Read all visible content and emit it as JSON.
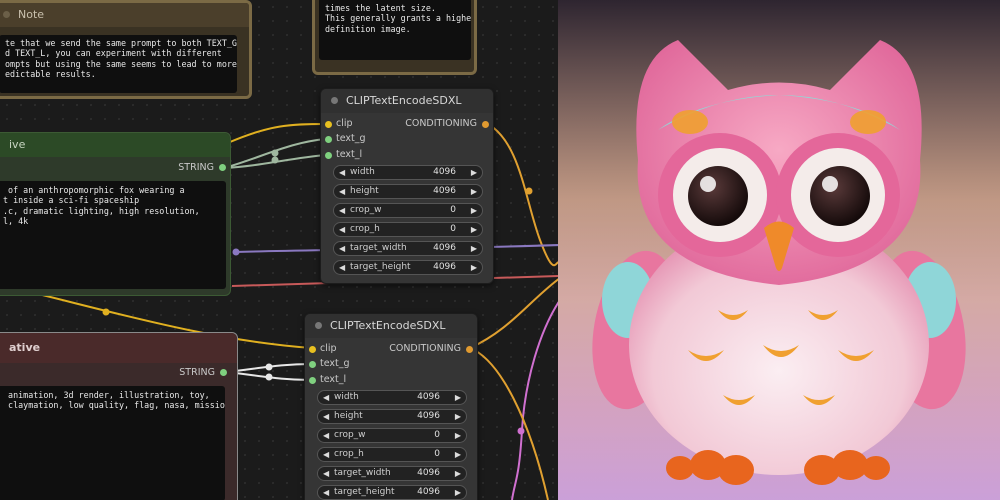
{
  "note_top_left": {
    "title": "Note",
    "lines": [
      "te that we send the same prompt to both TEXT_G",
      "d TEXT_L, you can experiment with different",
      "ompts but using the same seems to lead to more",
      "edictable results."
    ]
  },
  "note_top_center": {
    "lines": [
      "times the latent size.",
      "",
      "This generally grants a higher",
      "definition image."
    ]
  },
  "positive_node": {
    "title": "ive",
    "output_label": "STRING",
    "lines": [
      " of an anthropomorphic fox wearing a",
      "t inside a sci-fi spaceship",
      "",
      ".c, dramatic lighting, high resolution,",
      "l, 4k"
    ]
  },
  "negative_node": {
    "title": "ative",
    "output_label": "STRING",
    "lines": [
      " animation, 3d render, illustration, toy,",
      " claymation, low quality, flag, nasa, mission"
    ]
  },
  "clip_nodes": [
    {
      "title": "CLIPTextEncodeSDXL",
      "inputs": [
        "clip",
        "text_g",
        "text_l"
      ],
      "output": "CONDITIONING",
      "widgets": [
        {
          "label": "width",
          "value": "4096"
        },
        {
          "label": "height",
          "value": "4096"
        },
        {
          "label": "crop_w",
          "value": "0"
        },
        {
          "label": "crop_h",
          "value": "0"
        },
        {
          "label": "target_width",
          "value": "4096"
        },
        {
          "label": "target_height",
          "value": "4096"
        }
      ]
    },
    {
      "title": "CLIPTextEncodeSDXL",
      "inputs": [
        "clip",
        "text_g",
        "text_l"
      ],
      "output": "CONDITIONING",
      "widgets": [
        {
          "label": "width",
          "value": "4096"
        },
        {
          "label": "height",
          "value": "4096"
        },
        {
          "label": "crop_w",
          "value": "0"
        },
        {
          "label": "crop_h",
          "value": "0"
        },
        {
          "label": "target_width",
          "value": "4096"
        },
        {
          "label": "target_height",
          "value": "4096"
        }
      ]
    }
  ],
  "colors": {
    "clip_wire": "#e0b020",
    "string_wire": "#9fb79f",
    "conditioning_wire": "#e0a030",
    "latent_wire": "#a080d0",
    "image_wire": "#d060c0",
    "model_wire": "#d06060",
    "port_clip": "#e8c020",
    "port_text": "#7fd07f",
    "port_conditioning": "#e09a30"
  },
  "image": {
    "subject": "owl-figurine"
  }
}
